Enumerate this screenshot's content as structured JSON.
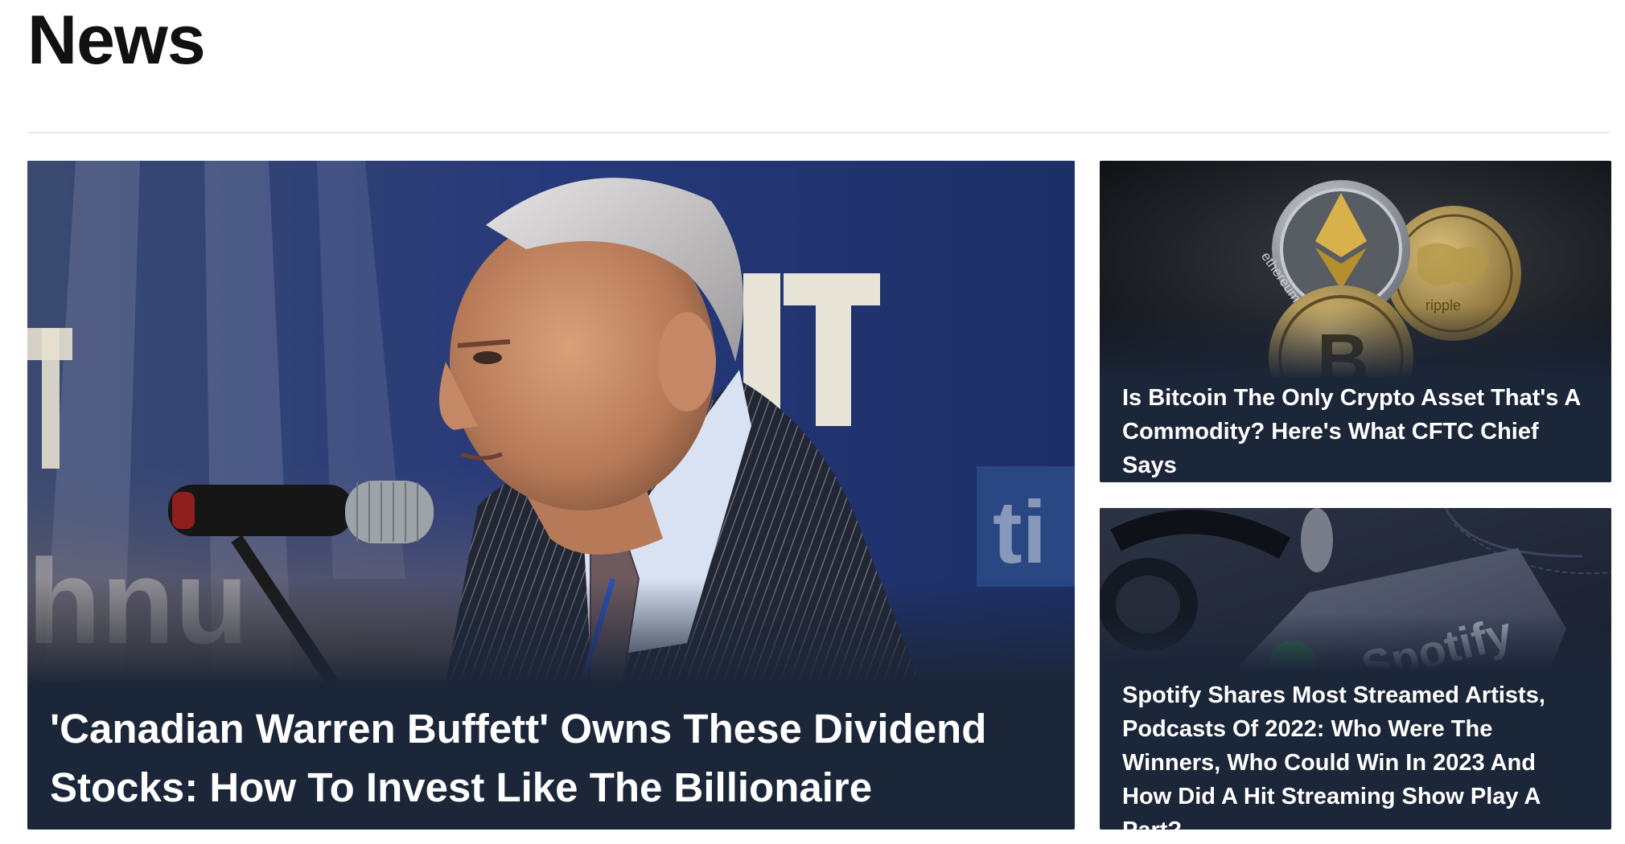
{
  "section": {
    "title": "News"
  },
  "articles": {
    "main": {
      "headline": "'Canadian Warren Buffett' Owns These Dividend Stocks: How To Invest Like The Billionaire",
      "image": "man-speaking-at-microphone"
    },
    "side": [
      {
        "headline": "Is Bitcoin The Only Crypto Asset That's A Commodity? Here's What CFTC Chief Says",
        "image": "crypto-coins",
        "coin_labels": [
          "ethereum",
          "ripple"
        ]
      },
      {
        "headline": "Spotify Shares Most Streamed Artists, Podcasts Of 2022: Who Were The Winners, Who Could Win In 2023 And How Did A Hit Streaming Show Play A Part?",
        "image": "spotify-phone-headphones",
        "brand_label": "Spotify"
      }
    ]
  },
  "colors": {
    "card_bg": "#1c2639",
    "divider": "#e3edf4",
    "title": "#111111"
  }
}
